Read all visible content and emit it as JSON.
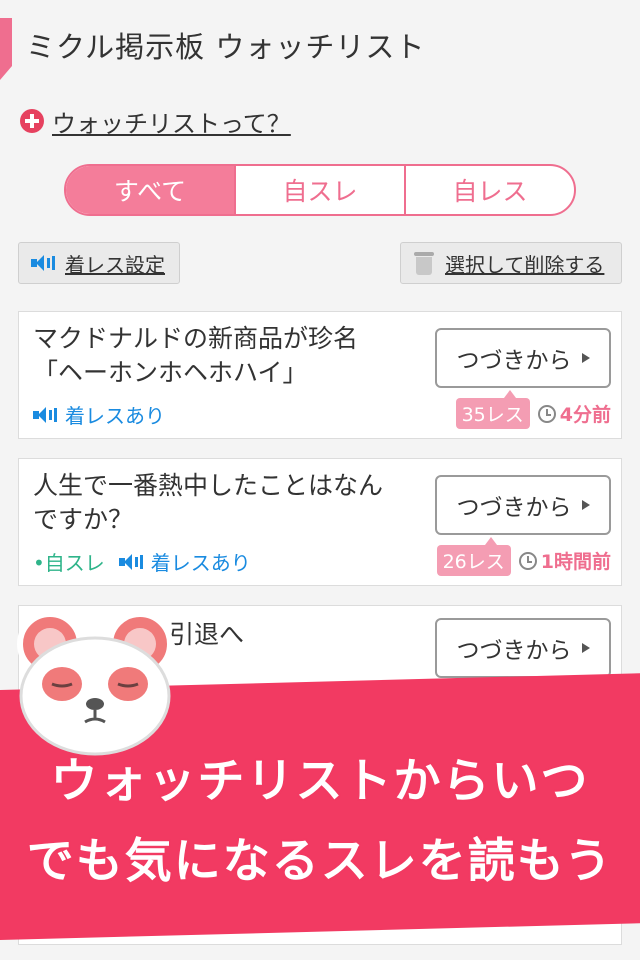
{
  "header": {
    "title": "ミクル掲示板 ウォッチリスト"
  },
  "help": {
    "label": "ウォッチリストって？"
  },
  "tabs": [
    {
      "label": "すべて",
      "active": true
    },
    {
      "label": "自スレ",
      "active": false
    },
    {
      "label": "自レス",
      "active": false
    }
  ],
  "toolbar": {
    "notify_settings_label": "着レス設定",
    "delete_selected_label": "選択して削除する"
  },
  "threads": [
    {
      "title_lines": [
        "マクドナルドの新商品が珍名",
        "「ヘーホンホヘホハイ」"
      ],
      "self_thread": "",
      "notify": "着レスあり",
      "res_count": "35レス",
      "time_ago": "4分前",
      "continue_label": "つづきから"
    },
    {
      "title_lines": [
        "人生で一番熱中したことはなん",
        "ですか？"
      ],
      "self_thread": "•自スレ",
      "notify": "着レスあり",
      "res_count": "26レス",
      "time_ago": "1時間前",
      "continue_label": "つづきから"
    },
    {
      "title_lines": [
        "引退へ",
        ""
      ],
      "continue_label": "つづきから"
    }
  ],
  "promo": {
    "line1": "ウォッチリストからいつ",
    "line2": "でも気になるスレを読もう"
  },
  "colors": {
    "accent_pink": "#ef6e8f",
    "banner_red": "#f23a62",
    "notify_blue": "#1a8be0",
    "self_green": "#2fb48a"
  }
}
